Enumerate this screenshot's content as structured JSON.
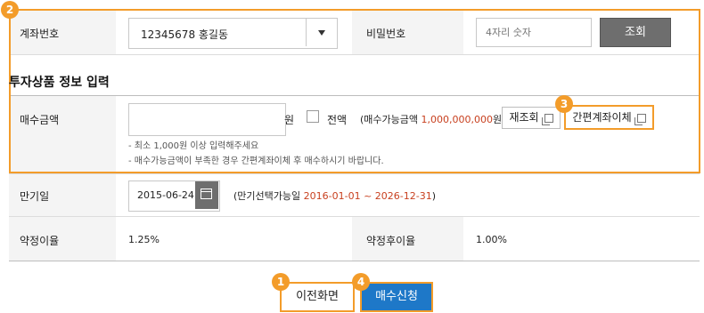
{
  "account": {
    "label": "계좌번호",
    "selected": "12345678 홍길동",
    "password_label": "비밀번호",
    "password_placeholder": "4자리 숫자",
    "query_button": "조회"
  },
  "section_title": "투자상품 정보 입력",
  "purchase": {
    "label": "매수금액",
    "unit": "원",
    "all_label": "전액",
    "available_prefix": "(매수가능금액 ",
    "available_amount": "1,000,000,000",
    "available_suffix": "원)",
    "requery_button": "재조회",
    "transfer_button": "간편계좌이체",
    "notes": [
      "- 최소 1,000원 이상 입력해주세요",
      "- 매수가능금액이 부족한 경우 간편계좌이체 후 매수하시기 바랍니다."
    ]
  },
  "maturity": {
    "label": "만기일",
    "date": "2015-06-24",
    "range_prefix": "(만기선택가능일 ",
    "range_value": "2016-01-01 ~ 2026-12-31",
    "range_suffix": ")"
  },
  "rates": {
    "agreed_label": "약정이율",
    "agreed_value": "1.25%",
    "after_label": "약정후이율",
    "after_value": "1.00%"
  },
  "buttons": {
    "prev": "이전화면",
    "buy": "매수신청"
  },
  "badges": {
    "b1": "1",
    "b2": "2",
    "b3": "3",
    "b4": "4"
  },
  "colors": {
    "accent_orange": "#f39c2a",
    "highlight_red": "#c8401f",
    "primary_blue": "#1e78c8",
    "dark_button": "#6e6e6e"
  }
}
